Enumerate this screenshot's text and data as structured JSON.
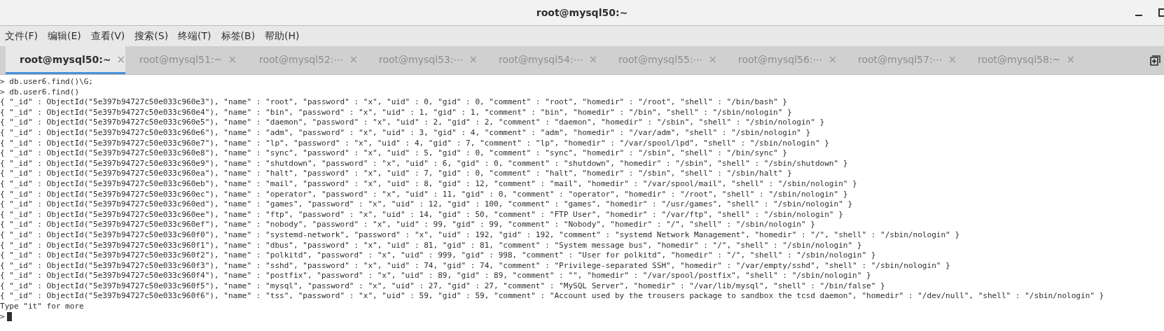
{
  "window": {
    "title": "root@mysql50:~"
  },
  "menu": [
    "文件(F)",
    "编辑(E)",
    "查看(V)",
    "搜索(S)",
    "终端(T)",
    "标签(B)",
    "帮助(H)"
  ],
  "tabs": [
    {
      "label": "root@mysql50:~",
      "selected": true
    },
    {
      "label": "root@mysql51:~",
      "selected": false
    },
    {
      "label": "root@mysql52:⋯",
      "selected": false
    },
    {
      "label": "root@mysql53:⋯",
      "selected": false
    },
    {
      "label": "root@mysql54:⋯",
      "selected": false
    },
    {
      "label": "root@mysql55:⋯",
      "selected": false
    },
    {
      "label": "root@mysql56:⋯",
      "selected": false
    },
    {
      "label": "root@mysql57:⋯",
      "selected": false
    },
    {
      "label": "root@mysql58:~",
      "selected": false
    }
  ],
  "tab_close": "×",
  "terminal": {
    "lines": [
      "> db.user6.find()\\G;",
      "> db.user6.find()",
      "{ \"_id\" : ObjectId(\"5e397b94727c50e033c960e3\"), \"name\" : \"root\", \"password\" : \"x\", \"uid\" : 0, \"gid\" : 0, \"comment\" : \"root\", \"homedir\" : \"/root\", \"shell\" : \"/bin/bash\" }",
      "{ \"_id\" : ObjectId(\"5e397b94727c50e033c960e4\"), \"name\" : \"bin\", \"password\" : \"x\", \"uid\" : 1, \"gid\" : 1, \"comment\" : \"bin\", \"homedir\" : \"/bin\", \"shell\" : \"/sbin/nologin\" }",
      "{ \"_id\" : ObjectId(\"5e397b94727c50e033c960e5\"), \"name\" : \"daemon\", \"password\" : \"x\", \"uid\" : 2, \"gid\" : 2, \"comment\" : \"daemon\", \"homedir\" : \"/sbin\", \"shell\" : \"/sbin/nologin\" }",
      "{ \"_id\" : ObjectId(\"5e397b94727c50e033c960e6\"), \"name\" : \"adm\", \"password\" : \"x\", \"uid\" : 3, \"gid\" : 4, \"comment\" : \"adm\", \"homedir\" : \"/var/adm\", \"shell\" : \"/sbin/nologin\" }",
      "{ \"_id\" : ObjectId(\"5e397b94727c50e033c960e7\"), \"name\" : \"lp\", \"password\" : \"x\", \"uid\" : 4, \"gid\" : 7, \"comment\" : \"lp\", \"homedir\" : \"/var/spool/lpd\", \"shell\" : \"/sbin/nologin\" }",
      "{ \"_id\" : ObjectId(\"5e397b94727c50e033c960e8\"), \"name\" : \"sync\", \"password\" : \"x\", \"uid\" : 5, \"gid\" : 0, \"comment\" : \"sync\", \"homedir\" : \"/sbin\", \"shell\" : \"/bin/sync\" }",
      "{ \"_id\" : ObjectId(\"5e397b94727c50e033c960e9\"), \"name\" : \"shutdown\", \"password\" : \"x\", \"uid\" : 6, \"gid\" : 0, \"comment\" : \"shutdown\", \"homedir\" : \"/sbin\", \"shell\" : \"/sbin/shutdown\" }",
      "{ \"_id\" : ObjectId(\"5e397b94727c50e033c960ea\"), \"name\" : \"halt\", \"password\" : \"x\", \"uid\" : 7, \"gid\" : 0, \"comment\" : \"halt\", \"homedir\" : \"/sbin\", \"shell\" : \"/sbin/halt\" }",
      "{ \"_id\" : ObjectId(\"5e397b94727c50e033c960eb\"), \"name\" : \"mail\", \"password\" : \"x\", \"uid\" : 8, \"gid\" : 12, \"comment\" : \"mail\", \"homedir\" : \"/var/spool/mail\", \"shell\" : \"/sbin/nologin\" }",
      "{ \"_id\" : ObjectId(\"5e397b94727c50e033c960ec\"), \"name\" : \"operator\", \"password\" : \"x\", \"uid\" : 11, \"gid\" : 0, \"comment\" : \"operator\", \"homedir\" : \"/root\", \"shell\" : \"/sbin/nologin\" }",
      "{ \"_id\" : ObjectId(\"5e397b94727c50e033c960ed\"), \"name\" : \"games\", \"password\" : \"x\", \"uid\" : 12, \"gid\" : 100, \"comment\" : \"games\", \"homedir\" : \"/usr/games\", \"shell\" : \"/sbin/nologin\" }",
      "{ \"_id\" : ObjectId(\"5e397b94727c50e033c960ee\"), \"name\" : \"ftp\", \"password\" : \"x\", \"uid\" : 14, \"gid\" : 50, \"comment\" : \"FTP User\", \"homedir\" : \"/var/ftp\", \"shell\" : \"/sbin/nologin\" }",
      "{ \"_id\" : ObjectId(\"5e397b94727c50e033c960ef\"), \"name\" : \"nobody\", \"password\" : \"x\", \"uid\" : 99, \"gid\" : 99, \"comment\" : \"Nobody\", \"homedir\" : \"/\", \"shell\" : \"/sbin/nologin\" }",
      "{ \"_id\" : ObjectId(\"5e397b94727c50e033c960f0\"), \"name\" : \"systemd-network\", \"password\" : \"x\", \"uid\" : 192, \"gid\" : 192, \"comment\" : \"systemd Network Management\", \"homedir\" : \"/\", \"shell\" : \"/sbin/nologin\" }",
      "{ \"_id\" : ObjectId(\"5e397b94727c50e033c960f1\"), \"name\" : \"dbus\", \"password\" : \"x\", \"uid\" : 81, \"gid\" : 81, \"comment\" : \"System message bus\", \"homedir\" : \"/\", \"shell\" : \"/sbin/nologin\" }",
      "{ \"_id\" : ObjectId(\"5e397b94727c50e033c960f2\"), \"name\" : \"polkitd\", \"password\" : \"x\", \"uid\" : 999, \"gid\" : 998, \"comment\" : \"User for polkitd\", \"homedir\" : \"/\", \"shell\" : \"/sbin/nologin\" }",
      "{ \"_id\" : ObjectId(\"5e397b94727c50e033c960f3\"), \"name\" : \"sshd\", \"password\" : \"x\", \"uid\" : 74, \"gid\" : 74, \"comment\" : \"Privilege-separated SSH\", \"homedir\" : \"/var/empty/sshd\", \"shell\" : \"/sbin/nologin\" }",
      "{ \"_id\" : ObjectId(\"5e397b94727c50e033c960f4\"), \"name\" : \"postfix\", \"password\" : \"x\", \"uid\" : 89, \"gid\" : 89, \"comment\" : \"\", \"homedir\" : \"/var/spool/postfix\", \"shell\" : \"/sbin/nologin\" }",
      "{ \"_id\" : ObjectId(\"5e397b94727c50e033c960f5\"), \"name\" : \"mysql\", \"password\" : \"x\", \"uid\" : 27, \"gid\" : 27, \"comment\" : \"MySQL Server\", \"homedir\" : \"/var/lib/mysql\", \"shell\" : \"/bin/false\" }",
      "{ \"_id\" : ObjectId(\"5e397b94727c50e033c960f6\"), \"name\" : \"tss\", \"password\" : \"x\", \"uid\" : 59, \"gid\" : 59, \"comment\" : \"Account used by the trousers package to sandbox the tcsd daemon\", \"homedir\" : \"/dev/null\", \"shell\" : \"/sbin/nologin\" }",
      "Type \"it\" for more"
    ],
    "prompt": ">"
  }
}
